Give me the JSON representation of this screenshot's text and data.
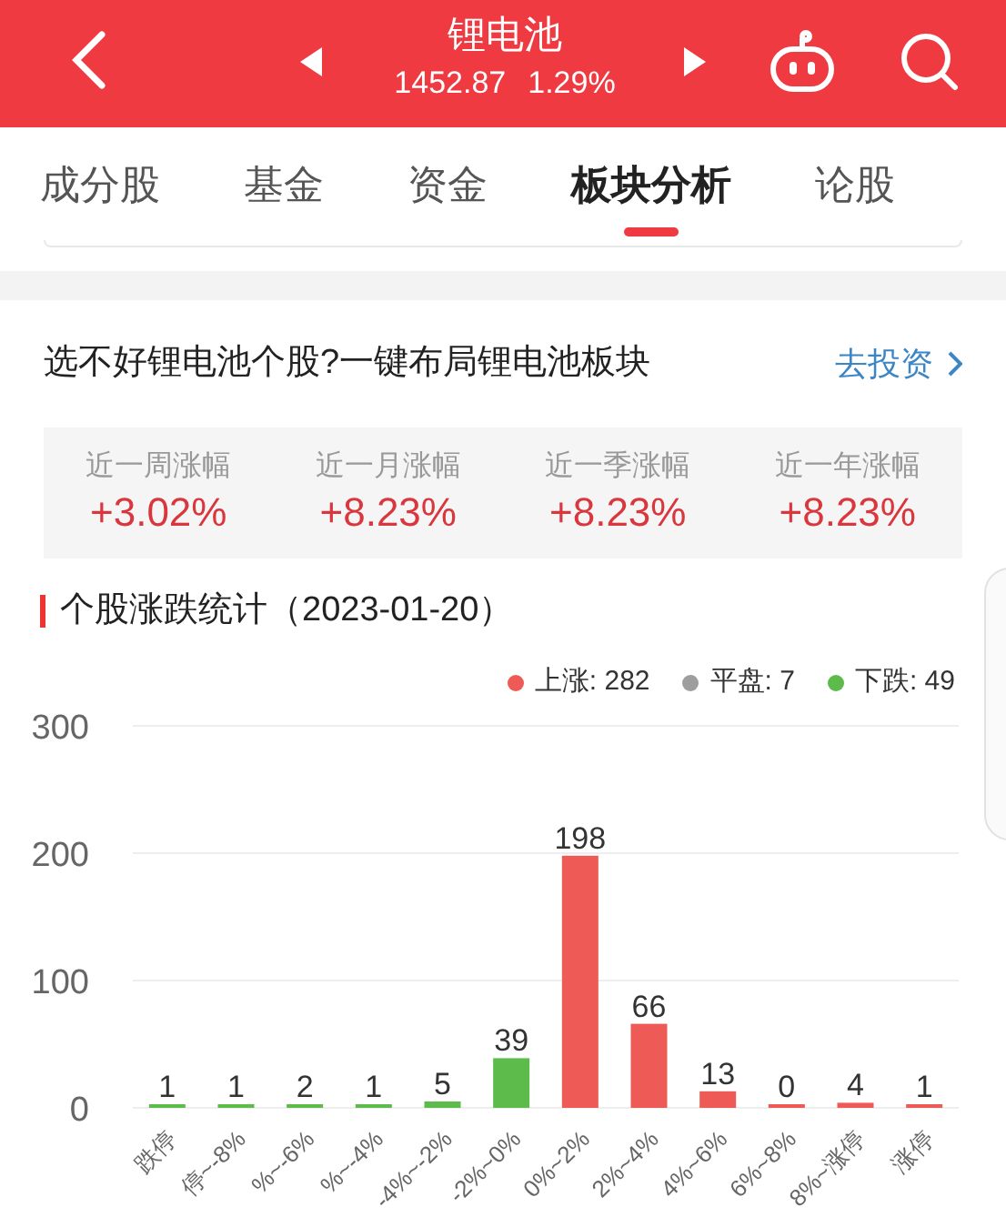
{
  "header": {
    "title": "锂电池",
    "price": "1452.87",
    "change": "1.29%"
  },
  "tabs": [
    {
      "label": "成分股",
      "selected": false
    },
    {
      "label": "基金",
      "selected": false
    },
    {
      "label": "资金",
      "selected": false
    },
    {
      "label": "板块分析",
      "selected": true
    },
    {
      "label": "论股",
      "selected": false
    }
  ],
  "promo": {
    "text": "选不好锂电池个股?一键布局锂电池板块",
    "link": "去投资"
  },
  "returns": [
    {
      "label": "近一周涨幅",
      "value": "+3.02%"
    },
    {
      "label": "近一月涨幅",
      "value": "+8.23%"
    },
    {
      "label": "近一季涨幅",
      "value": "+8.23%"
    },
    {
      "label": "近一年涨幅",
      "value": "+8.23%"
    }
  ],
  "section_title": "个股涨跌统计（2023-01-20）",
  "legend": [
    {
      "label": "上涨: 282",
      "color": "#ee5a55"
    },
    {
      "label": "平盘: 7",
      "color": "#9e9e9e"
    },
    {
      "label": "下跌: 49",
      "color": "#5dbb4c"
    }
  ],
  "chart_data": {
    "type": "bar",
    "categories": [
      "跌停",
      "停~-8%",
      "%~-6%",
      "%~-4%",
      "-4%~-2%",
      "-2%~0%",
      "0%~2%",
      "2%~4%",
      "4%~6%",
      "6%~8%",
      "8%~涨停",
      "涨停"
    ],
    "series": [
      {
        "color": "#5dbb4c",
        "values": [
          1,
          1,
          2,
          1,
          5,
          39,
          null,
          null,
          null,
          null,
          null,
          null
        ]
      },
      {
        "color": "#ee5a55",
        "values": [
          null,
          null,
          null,
          null,
          null,
          null,
          198,
          66,
          13,
          0,
          4,
          1
        ]
      }
    ],
    "ylim": [
      0,
      300
    ],
    "yticks": [
      0,
      100,
      200,
      300
    ],
    "data_labels": true
  }
}
